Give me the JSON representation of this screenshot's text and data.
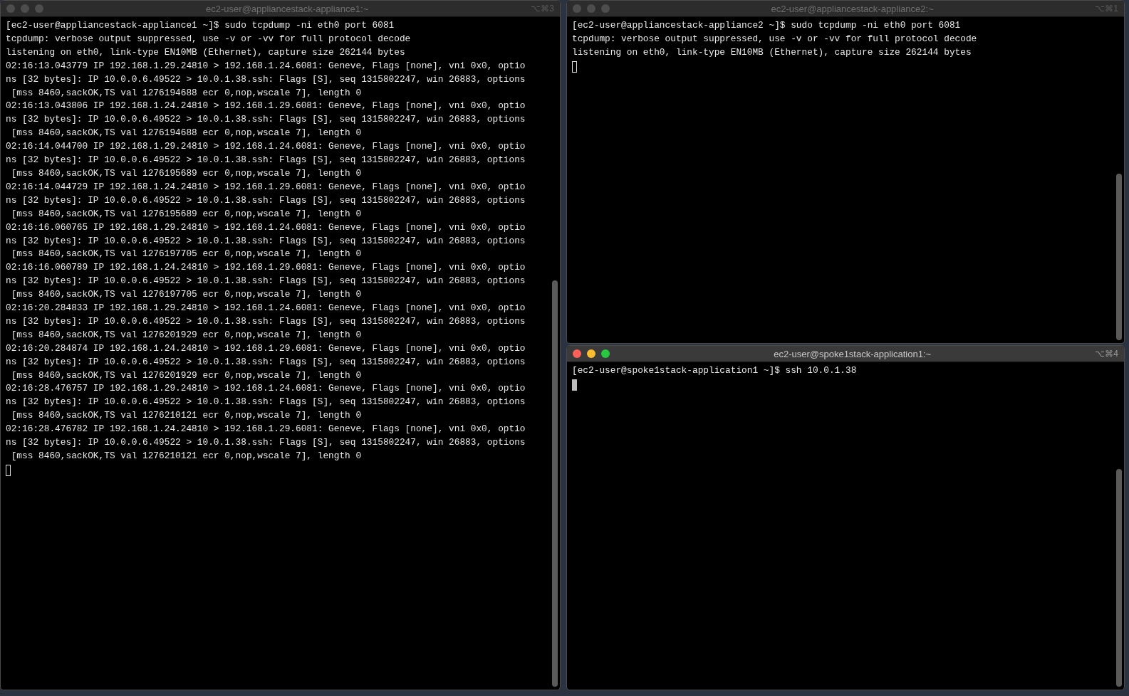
{
  "windows": [
    {
      "title": "ec2-user@appliancestack-appliance1:~",
      "shortcut": "⌥⌘3",
      "focused": false,
      "cursor_filled": false,
      "lines": [
        "[ec2-user@appliancestack-appliance1 ~]$ sudo tcpdump -ni eth0 port 6081",
        "tcpdump: verbose output suppressed, use -v or -vv for full protocol decode",
        "listening on eth0, link-type EN10MB (Ethernet), capture size 262144 bytes",
        "02:16:13.043779 IP 192.168.1.29.24810 > 192.168.1.24.6081: Geneve, Flags [none], vni 0x0, optio",
        "ns [32 bytes]: IP 10.0.0.6.49522 > 10.0.1.38.ssh: Flags [S], seq 1315802247, win 26883, options",
        " [mss 8460,sackOK,TS val 1276194688 ecr 0,nop,wscale 7], length 0",
        "02:16:13.043806 IP 192.168.1.24.24810 > 192.168.1.29.6081: Geneve, Flags [none], vni 0x0, optio",
        "ns [32 bytes]: IP 10.0.0.6.49522 > 10.0.1.38.ssh: Flags [S], seq 1315802247, win 26883, options",
        " [mss 8460,sackOK,TS val 1276194688 ecr 0,nop,wscale 7], length 0",
        "02:16:14.044700 IP 192.168.1.29.24810 > 192.168.1.24.6081: Geneve, Flags [none], vni 0x0, optio",
        "ns [32 bytes]: IP 10.0.0.6.49522 > 10.0.1.38.ssh: Flags [S], seq 1315802247, win 26883, options",
        " [mss 8460,sackOK,TS val 1276195689 ecr 0,nop,wscale 7], length 0",
        "02:16:14.044729 IP 192.168.1.24.24810 > 192.168.1.29.6081: Geneve, Flags [none], vni 0x0, optio",
        "ns [32 bytes]: IP 10.0.0.6.49522 > 10.0.1.38.ssh: Flags [S], seq 1315802247, win 26883, options",
        " [mss 8460,sackOK,TS val 1276195689 ecr 0,nop,wscale 7], length 0",
        "02:16:16.060765 IP 192.168.1.29.24810 > 192.168.1.24.6081: Geneve, Flags [none], vni 0x0, optio",
        "ns [32 bytes]: IP 10.0.0.6.49522 > 10.0.1.38.ssh: Flags [S], seq 1315802247, win 26883, options",
        " [mss 8460,sackOK,TS val 1276197705 ecr 0,nop,wscale 7], length 0",
        "02:16:16.060789 IP 192.168.1.24.24810 > 192.168.1.29.6081: Geneve, Flags [none], vni 0x0, optio",
        "ns [32 bytes]: IP 10.0.0.6.49522 > 10.0.1.38.ssh: Flags [S], seq 1315802247, win 26883, options",
        " [mss 8460,sackOK,TS val 1276197705 ecr 0,nop,wscale 7], length 0",
        "02:16:20.284833 IP 192.168.1.29.24810 > 192.168.1.24.6081: Geneve, Flags [none], vni 0x0, optio",
        "ns [32 bytes]: IP 10.0.0.6.49522 > 10.0.1.38.ssh: Flags [S], seq 1315802247, win 26883, options",
        " [mss 8460,sackOK,TS val 1276201929 ecr 0,nop,wscale 7], length 0",
        "02:16:20.284874 IP 192.168.1.24.24810 > 192.168.1.29.6081: Geneve, Flags [none], vni 0x0, optio",
        "ns [32 bytes]: IP 10.0.0.6.49522 > 10.0.1.38.ssh: Flags [S], seq 1315802247, win 26883, options",
        " [mss 8460,sackOK,TS val 1276201929 ecr 0,nop,wscale 7], length 0",
        "02:16:28.476757 IP 192.168.1.29.24810 > 192.168.1.24.6081: Geneve, Flags [none], vni 0x0, optio",
        "ns [32 bytes]: IP 10.0.0.6.49522 > 10.0.1.38.ssh: Flags [S], seq 1315802247, win 26883, options",
        " [mss 8460,sackOK,TS val 1276210121 ecr 0,nop,wscale 7], length 0",
        "02:16:28.476782 IP 192.168.1.24.24810 > 192.168.1.29.6081: Geneve, Flags [none], vni 0x0, optio",
        "ns [32 bytes]: IP 10.0.0.6.49522 > 10.0.1.38.ssh: Flags [S], seq 1315802247, win 26883, options",
        " [mss 8460,sackOK,TS val 1276210121 ecr 0,nop,wscale 7], length 0"
      ]
    },
    {
      "title": "ec2-user@appliancestack-appliance2:~",
      "shortcut": "⌥⌘1",
      "focused": false,
      "cursor_filled": false,
      "lines": [
        "[ec2-user@appliancestack-appliance2 ~]$ sudo tcpdump -ni eth0 port 6081",
        "tcpdump: verbose output suppressed, use -v or -vv for full protocol decode",
        "listening on eth0, link-type EN10MB (Ethernet), capture size 262144 bytes"
      ]
    },
    {
      "title": "ec2-user@spoke1stack-application1:~",
      "shortcut": "⌥⌘4",
      "focused": true,
      "cursor_filled": true,
      "lines": [
        "[ec2-user@spoke1stack-application1 ~]$ ssh 10.0.1.38"
      ]
    }
  ]
}
